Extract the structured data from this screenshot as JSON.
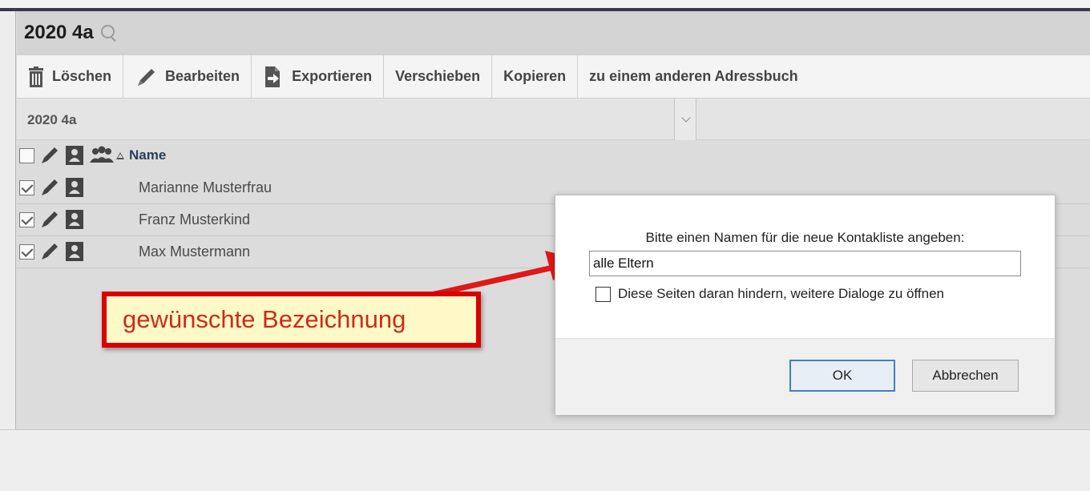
{
  "header": {
    "title": "2020 4a"
  },
  "toolbar": {
    "delete_label": "Löschen",
    "edit_label": "Bearbeiten",
    "export_label": "Exportieren",
    "move_label": "Verschieben",
    "copy_label": "Kopieren",
    "other_book_label": "zu einem anderen Adressbuch"
  },
  "filter": {
    "selected": "2020 4a"
  },
  "list": {
    "header": {
      "name_label": "Name",
      "sort": "ascending"
    },
    "rows": [
      {
        "name": "Marianne Musterfrau",
        "checked": true
      },
      {
        "name": "Franz Musterkind",
        "checked": true
      },
      {
        "name": "Max Mustermann",
        "checked": true
      }
    ]
  },
  "annotation": {
    "text": "gewünschte Bezeichnung"
  },
  "dialog": {
    "message": "Bitte einen Namen für die neue Kontakliste angeben:",
    "input_value": "alle Eltern",
    "prevent_label": "Diese Seiten daran hindern, weitere Dialoge zu öffnen",
    "prevent_checked": false,
    "ok_label": "OK",
    "cancel_label": "Abbrechen"
  },
  "colors": {
    "annotation_border": "#d80000",
    "annotation_fill": "#fff9c8",
    "annotation_text": "#cf2a1a",
    "ok_focus": "#3c7fd0"
  },
  "icons": [
    "search-icon",
    "trash-icon",
    "pencil-icon",
    "export-icon",
    "person-icon",
    "group-icon",
    "chevron-down-icon"
  ]
}
